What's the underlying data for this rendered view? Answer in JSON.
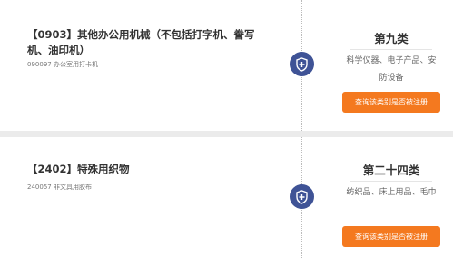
{
  "items": [
    {
      "title": "【0903】其他办公用机械（不包括打字机、誊写机、油印机）",
      "subtitle": "090097 办公室用打卡机",
      "class_title": "第九类",
      "class_desc": "科学仪器、电子产品、安防设备",
      "button": "查询该类别是否被注册"
    },
    {
      "title": "【2402】特殊用织物",
      "subtitle": "240057 非文具用胶布",
      "class_title": "第二十四类",
      "class_desc": "纺织品、床上用品、毛巾",
      "button": "查询该类别是否被注册"
    }
  ],
  "icon": "shield-plus-icon",
  "colors": {
    "accent": "#f4791f",
    "badge": "#3f5396",
    "separator": "#ebebeb"
  }
}
